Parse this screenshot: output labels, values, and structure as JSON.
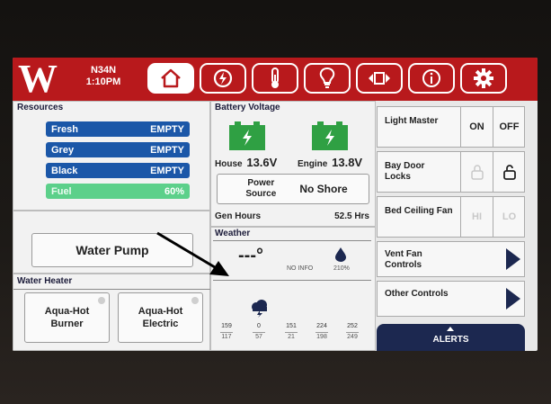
{
  "header": {
    "logo_text": "W",
    "unit_id": "N34N",
    "time": "1:10PM",
    "nav_icons": [
      "home-icon",
      "generator-icon",
      "thermometer-icon",
      "bulb-icon",
      "slide-out-icon",
      "info-icon",
      "gear-icon"
    ]
  },
  "resources": {
    "title": "Resources",
    "tanks": [
      {
        "name": "Fresh",
        "value": "EMPTY",
        "color": "#1b57a8"
      },
      {
        "name": "Grey",
        "value": "EMPTY",
        "color": "#1b57a8"
      },
      {
        "name": "Black",
        "value": "EMPTY",
        "color": "#1b57a8"
      },
      {
        "name": "Fuel",
        "value": "60%",
        "color": "#5cd08a"
      }
    ]
  },
  "battery": {
    "title": "Battery Voltage",
    "house_label": "House",
    "house_value": "13.6V",
    "engine_label": "Engine",
    "engine_value": "13.8V",
    "power_source_label": "Power Source",
    "power_source_value": "No Shore",
    "gen_hours_label": "Gen Hours",
    "gen_hours_value": "52.5 Hrs"
  },
  "water_pump": {
    "label": "Water Pump"
  },
  "water_heater": {
    "title": "Water Heater",
    "burner_label": "Aqua-Hot Burner",
    "electric_label": "Aqua-Hot Electric"
  },
  "weather": {
    "title": "Weather",
    "temp": "---°",
    "info": "NO INFO",
    "humidity": "210%",
    "forecast": [
      {
        "high": "159",
        "low": "117"
      },
      {
        "high": "0",
        "low": "57"
      },
      {
        "high": "151",
        "low": "21"
      },
      {
        "high": "224",
        "low": "198"
      },
      {
        "high": "252",
        "low": "249"
      }
    ]
  },
  "controls": {
    "light_master": {
      "label": "Light Master",
      "on": "ON",
      "off": "OFF"
    },
    "bay_door": {
      "label": "Bay Door Locks"
    },
    "bed_fan": {
      "label": "Bed Ceiling Fan",
      "hi": "HI",
      "lo": "LO"
    },
    "vent_fan": {
      "label": "Vent Fan Controls"
    },
    "other": {
      "label": "Other Controls"
    }
  },
  "alerts": {
    "label": "ALERTS"
  },
  "colors": {
    "header_red": "#b8191c",
    "navy": "#1c2850",
    "battery_green": "#2fa043"
  }
}
